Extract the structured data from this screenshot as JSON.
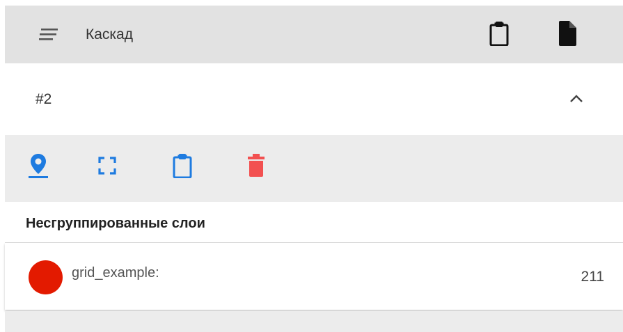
{
  "header": {
    "title": "Каскад",
    "menu_icon": "menu-lines-icon",
    "clipboard_icon": "clipboard-icon",
    "file_icon": "file-icon"
  },
  "section": {
    "title": "#2",
    "expanded": true,
    "chevron_icon": "chevron-up-icon"
  },
  "toolbar": {
    "items": [
      {
        "icon": "location-pin-icon",
        "color": "#1e7be0"
      },
      {
        "icon": "fullscreen-icon",
        "color": "#1e7be0"
      },
      {
        "icon": "clipboard-icon",
        "color": "#1e7be0"
      },
      {
        "icon": "trash-icon",
        "color": "#f25050"
      }
    ]
  },
  "group": {
    "heading": "Несгруппированные слои"
  },
  "layers": [
    {
      "name": "grid_example:",
      "count": "211",
      "color": "#e31a00"
    }
  ],
  "colors": {
    "header_bg": "#e2e2e2",
    "toolbar_bg": "#ececec",
    "accent_blue": "#1e7be0",
    "danger_red": "#f25050"
  }
}
